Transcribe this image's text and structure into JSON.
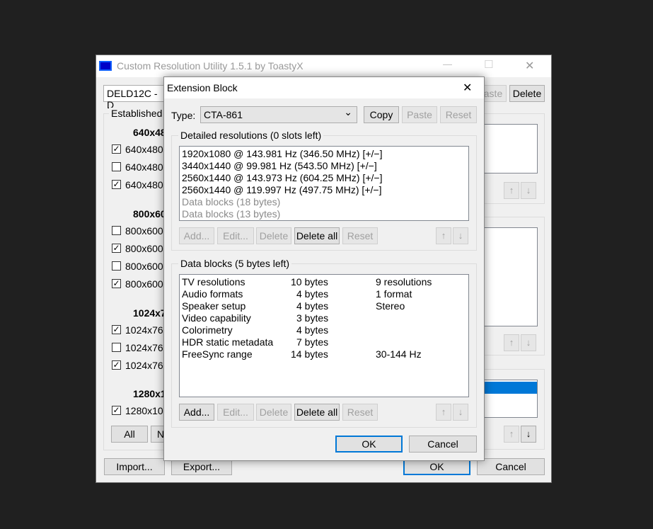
{
  "main_window": {
    "title": "Custom Resolution Utility 1.5.1 by ToastyX",
    "display_select": "DELD12C - D",
    "paste_label": "aste",
    "delete_label": "Delete",
    "established_label": "Established r",
    "res_groups": [
      {
        "header": "640x48",
        "items": [
          {
            "label": "640x480",
            "checked": true
          },
          {
            "label": "640x480",
            "checked": false
          },
          {
            "label": "640x480",
            "checked": true
          }
        ]
      },
      {
        "header": "800x60",
        "items": [
          {
            "label": "800x600",
            "checked": false
          },
          {
            "label": "800x600",
            "checked": true
          },
          {
            "label": "800x600",
            "checked": false
          },
          {
            "label": "800x600",
            "checked": true
          }
        ]
      },
      {
        "header": "1024x7",
        "items": [
          {
            "label": "1024x76",
            "checked": true
          },
          {
            "label": "1024x76",
            "checked": false
          },
          {
            "label": "1024x76",
            "checked": true
          }
        ]
      },
      {
        "header": "1280x1",
        "items": [
          {
            "label": "1280x10",
            "checked": true
          }
        ]
      }
    ],
    "all_label": "All",
    "none_label": "N",
    "import_label": "Import...",
    "export_label": "Export...",
    "ok_label": "OK",
    "cancel_label": "Cancel"
  },
  "dialog": {
    "title": "Extension Block",
    "type_label": "Type:",
    "type_value": "CTA-861",
    "copy_label": "Copy",
    "paste_label": "Paste",
    "reset_label": "Reset",
    "detailed_group_label": "Detailed resolutions (0 slots left)",
    "detailed_items": [
      {
        "text": "1920x1080 @ 143.981 Hz (346.50 MHz) [+/−]",
        "muted": false
      },
      {
        "text": "3440x1440 @ 99.981 Hz (543.50 MHz) [+/−]",
        "muted": false
      },
      {
        "text": "2560x1440 @ 143.973 Hz (604.25 MHz) [+/−]",
        "muted": false
      },
      {
        "text": "2560x1440 @ 119.997 Hz (497.75 MHz) [+/−]",
        "muted": false
      },
      {
        "text": "Data blocks (18 bytes)",
        "muted": true
      },
      {
        "text": "Data blocks (13 bytes)",
        "muted": true
      }
    ],
    "add_label": "Add...",
    "edit_label": "Edit...",
    "delete_label": "Delete",
    "delete_all_label": "Delete all",
    "data_group_label": "Data blocks (5 bytes left)",
    "data_items": [
      {
        "name": "TV resolutions",
        "size": "10 bytes",
        "info": "9 resolutions"
      },
      {
        "name": "Audio formats",
        "size": "4 bytes",
        "info": "1 format"
      },
      {
        "name": "Speaker setup",
        "size": "4 bytes",
        "info": "Stereo"
      },
      {
        "name": "Video capability",
        "size": "3 bytes",
        "info": ""
      },
      {
        "name": "Colorimetry",
        "size": "4 bytes",
        "info": ""
      },
      {
        "name": "HDR static metadata",
        "size": "7 bytes",
        "info": ""
      },
      {
        "name": "FreeSync range",
        "size": "14 bytes",
        "info": "30-144 Hz"
      }
    ],
    "ok_label": "OK",
    "cancel_label": "Cancel"
  },
  "icons": {
    "up_arrow": "↑",
    "down_arrow": "↓",
    "close": "✕",
    "minimize": "—",
    "maximize": "☐",
    "chevron": "⌄",
    "check": "✓"
  },
  "colors": {
    "selection": "#0078d7",
    "default_button_border": "#0078d7"
  }
}
